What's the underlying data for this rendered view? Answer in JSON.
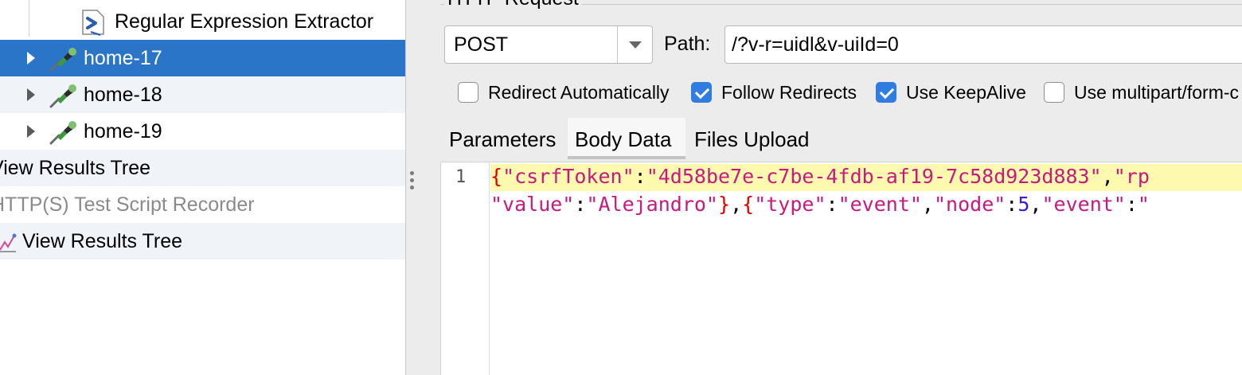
{
  "tree": {
    "items": [
      {
        "label": "Regular Expression Extractor"
      },
      {
        "label": "home-17"
      },
      {
        "label": "home-18"
      },
      {
        "label": "home-19"
      },
      {
        "label": "View Results Tree"
      },
      {
        "label": "HTTP(S) Test Script Recorder"
      },
      {
        "label": "View Results Tree"
      }
    ]
  },
  "request": {
    "section_title": "HTTP Request",
    "method": "POST",
    "path_label": "Path:",
    "path_value": "/?v-r=uidl&v-uiId=0"
  },
  "options": [
    {
      "label": "Redirect Automatically",
      "checked": false
    },
    {
      "label": "Follow Redirects",
      "checked": true
    },
    {
      "label": "Use KeepAlive",
      "checked": true
    },
    {
      "label": "Use multipart/form-c",
      "checked": false
    }
  ],
  "tabs": [
    {
      "label": "Parameters"
    },
    {
      "label": "Body Data",
      "active": true
    },
    {
      "label": "Files Upload"
    }
  ],
  "body_data": {
    "line_number": "1",
    "line1": {
      "brace": "{",
      "key1": "\"csrfToken\"",
      "colon": ":",
      "val1": "\"4d58be7e-c7be-4fdb-af19-7c58d923d883\"",
      "comma": ",",
      "key2": "\"rp"
    },
    "line2": {
      "key": "\"value\"",
      "colon": ":",
      "val": "\"Alejandro\"",
      "close": "}",
      "comma": ",",
      "brace": "{",
      "k_type": "\"type\"",
      "v_type": "\"event\"",
      "k_node": "\"node\"",
      "v_node": "5",
      "k_event": "\"event\"",
      "tail": "\""
    }
  },
  "colors": {
    "selection": "#2b75c8",
    "checkbox_on": "#2f7de1",
    "json_string": "#c8197f",
    "json_number": "#3a1ad6",
    "json_brace": "#e00000",
    "line_highlight": "#fdfab0"
  }
}
